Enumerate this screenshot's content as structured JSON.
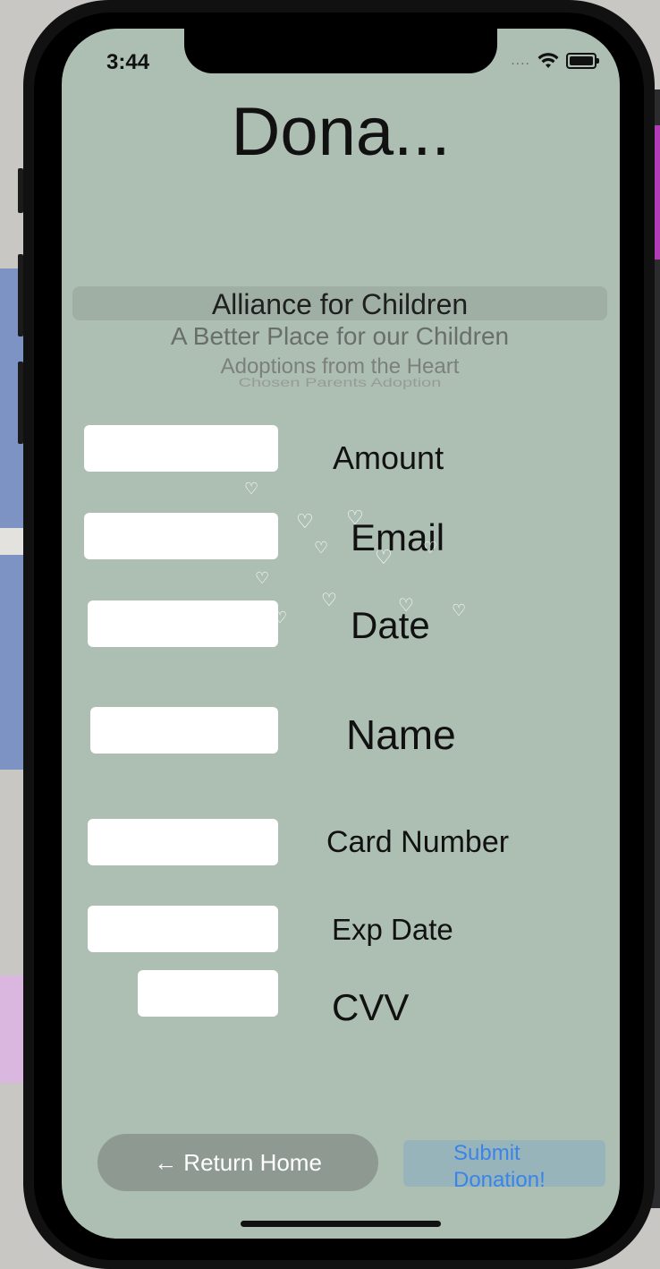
{
  "status_bar": {
    "time": "3:44",
    "signal_dots": "....",
    "wifi_icon": "wifi-icon",
    "battery_icon": "battery-icon"
  },
  "header": {
    "title": "Dona..."
  },
  "picker": {
    "options": [
      "Alliance for Children",
      "A Better Place for our Children",
      "Adoptions from the Heart",
      "Chosen Parents Adoption"
    ],
    "selected": "Alliance for Children"
  },
  "form": {
    "amount_label": "Amount",
    "email_label": "Email",
    "date_label": "Date",
    "name_label": "Name",
    "card_number_label": "Card Number",
    "exp_date_label": "Exp Date",
    "cvv_label": "CVV",
    "amount_value": "",
    "email_value": "",
    "date_value": "",
    "name_value": "",
    "card_number_value": "",
    "exp_date_value": "",
    "cvv_value": ""
  },
  "buttons": {
    "return_home": "← Return Home",
    "submit": "Submit Donation!"
  },
  "colors": {
    "screen_bg": "#adbfb2",
    "home_button_bg": "#8e9a91",
    "submit_button_bg": "#98b4bb",
    "submit_text": "#3a84e8"
  }
}
